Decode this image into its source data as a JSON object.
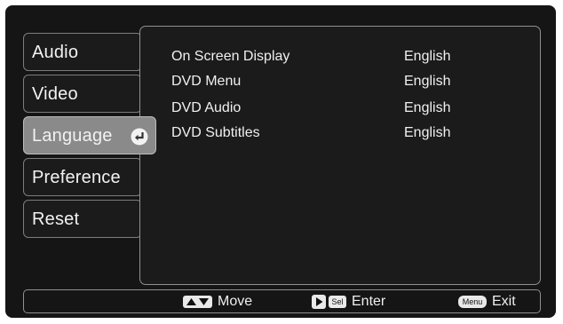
{
  "menu": {
    "tabs": [
      {
        "label": "Audio"
      },
      {
        "label": "Video"
      },
      {
        "label": "Language",
        "selected": true
      },
      {
        "label": "Preference"
      },
      {
        "label": "Reset"
      }
    ],
    "selected_icon": "enter-arrow-icon"
  },
  "settings": [
    {
      "label": "On Screen Display",
      "value": "English"
    },
    {
      "label": "DVD Menu",
      "value": "English"
    },
    {
      "label": "DVD Audio",
      "value": "English"
    },
    {
      "label": "DVD Subtitles",
      "value": "English"
    }
  ],
  "footer": {
    "move": {
      "icon": "up-down-arrows-icon",
      "label": "Move"
    },
    "enter": {
      "icon": "play-icon",
      "key": "Sel",
      "label": "Enter"
    },
    "exit": {
      "key": "Menu",
      "label": "Exit"
    }
  },
  "colors": {
    "background": "#151515",
    "selected_tab": "#8a8a8a",
    "border": "#909090",
    "text": "#f0f0f0"
  }
}
